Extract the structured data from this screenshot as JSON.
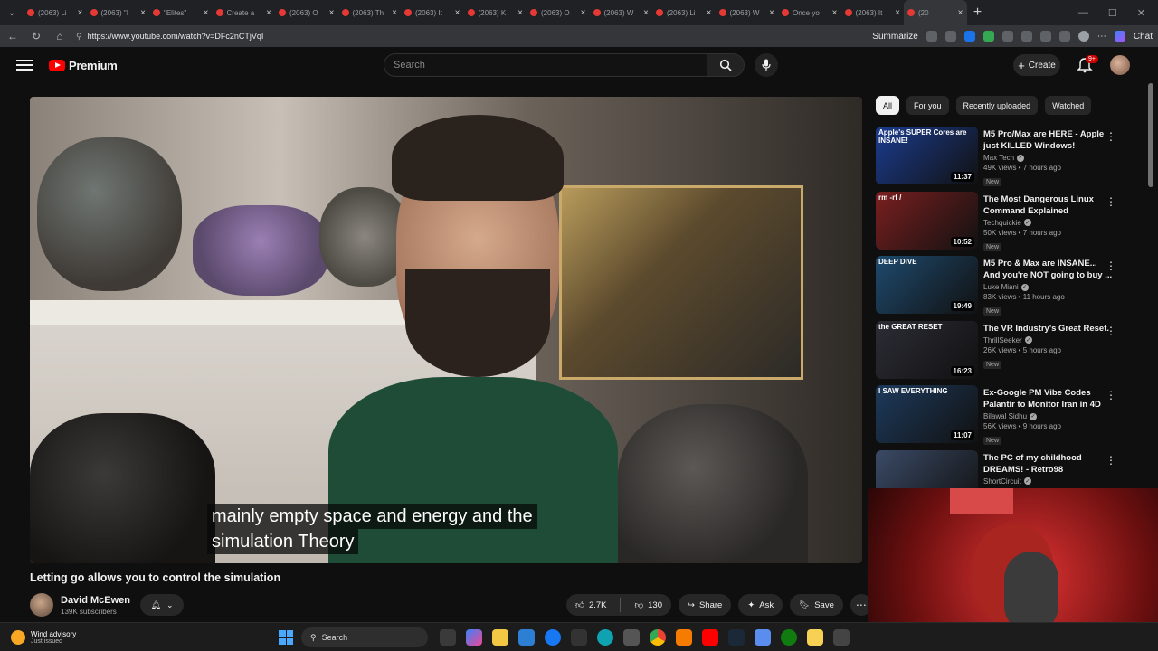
{
  "browser": {
    "tabs": [
      {
        "label": "(2063) Li",
        "active": false
      },
      {
        "label": "(2063) \"I",
        "active": false
      },
      {
        "label": "\"Elites\"",
        "active": false
      },
      {
        "label": "Create a",
        "active": false
      },
      {
        "label": "(2063) O",
        "active": false
      },
      {
        "label": "(2063) Th",
        "active": false
      },
      {
        "label": "(2063) It",
        "active": false
      },
      {
        "label": "(2063) K",
        "active": false
      },
      {
        "label": "(2063) O",
        "active": false
      },
      {
        "label": "(2063) W",
        "active": false
      },
      {
        "label": "(2063) Li",
        "active": false
      },
      {
        "label": "(2063) W",
        "active": false
      },
      {
        "label": "Once yo",
        "active": false
      },
      {
        "label": "(2063) It",
        "active": false
      },
      {
        "label": "(20",
        "active": true
      }
    ],
    "url": "https://www.youtube.com/watch?v=DFc2nCTjVqI",
    "summarize_label": "Summarize",
    "chat_label": "Chat"
  },
  "header": {
    "logo_text": "Premium",
    "search_placeholder": "Search",
    "create_label": "Create",
    "notif_badge": "9+"
  },
  "player": {
    "caption_line1": "mainly empty space and energy and the",
    "caption_line2": "simulation Theory"
  },
  "video": {
    "title": "Letting go allows you to control the simulation",
    "channel": "David McEwen",
    "subscribers": "139K subscribers",
    "likes": "2.7K",
    "dislikes": "130",
    "share_label": "Share",
    "ask_label": "Ask",
    "save_label": "Save"
  },
  "chips": [
    "All",
    "For you",
    "Recently uploaded",
    "Watched"
  ],
  "related": [
    {
      "title": "M5 Pro/Max are HERE - Apple just KILLED Windows!",
      "channel": "Max Tech",
      "views": "49K views • 7 hours ago",
      "badge": "New",
      "duration": "11:37",
      "thumb_text": "Apple's SUPER Cores are INSANE!",
      "thumb_color": "#1b3c8f"
    },
    {
      "title": "The Most Dangerous Linux Command Explained",
      "channel": "Techquickie",
      "views": "50K views • 7 hours ago",
      "badge": "New",
      "duration": "10:52",
      "thumb_text": "rm -rf /",
      "thumb_color": "#7a1f1f"
    },
    {
      "title": "M5 Pro & Max are INSANE... And you're NOT going to buy ...",
      "channel": "Luke Miani",
      "views": "83K views • 11 hours ago",
      "badge": "New",
      "duration": "19:49",
      "thumb_text": "DEEP DIVE",
      "thumb_color": "#1e4a6e"
    },
    {
      "title": "The VR Industry's Great Reset.",
      "channel": "ThrillSeeker",
      "views": "26K views • 5 hours ago",
      "badge": "New",
      "duration": "16:23",
      "thumb_text": "the GREAT RESET",
      "thumb_color": "#2c2c36"
    },
    {
      "title": "Ex-Google PM Vibe Codes Palantir to Monitor Iran in 4D",
      "channel": "Bilawal Sidhu",
      "views": "56K views • 9 hours ago",
      "badge": "New",
      "duration": "11:07",
      "thumb_text": "I SAW EVERYTHING",
      "thumb_color": "#1d3a5c"
    },
    {
      "title": "The PC of my childhood DREAMS! - Retro98",
      "channel": "ShortCircuit",
      "views": "",
      "badge": "",
      "duration": "",
      "thumb_text": "",
      "thumb_color": "#3a4a66"
    }
  ],
  "taskbar": {
    "weather_title": "Wind advisory",
    "weather_sub": "Just issued",
    "search_label": "Search"
  },
  "colors": {
    "brand": "#ff0000",
    "bg": "#0f0f0f",
    "chip_selected": "#f1f1f1"
  }
}
